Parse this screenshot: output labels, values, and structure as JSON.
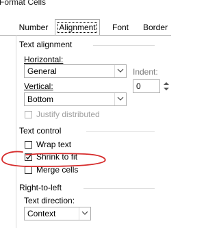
{
  "window": {
    "title": "Format Cells"
  },
  "tabs": [
    {
      "label": "Number",
      "active": false
    },
    {
      "label": "Alignment",
      "active": true
    },
    {
      "label": "Font",
      "active": false
    },
    {
      "label": "Border",
      "active": false
    }
  ],
  "text_alignment": {
    "group_label": "Text alignment",
    "horizontal": {
      "label": "Horizontal:",
      "value": "General"
    },
    "indent": {
      "label": "Indent:",
      "value": "0"
    },
    "vertical": {
      "label": "Vertical:",
      "value": "Bottom"
    },
    "justify_distributed": {
      "label": "Justify distributed",
      "checked": false,
      "enabled": false
    }
  },
  "text_control": {
    "group_label": "Text control",
    "wrap_text": {
      "label": "Wrap text",
      "checked": false
    },
    "shrink_to_fit": {
      "label": "Shrink to fit",
      "checked": true
    },
    "merge_cells": {
      "label": "Merge cells",
      "checked": false
    }
  },
  "right_to_left": {
    "group_label": "Right-to-left",
    "text_direction": {
      "label": "Text direction:",
      "value": "Context"
    }
  },
  "colors": {
    "annotation": "#d62b2b",
    "border": "#adadad"
  }
}
